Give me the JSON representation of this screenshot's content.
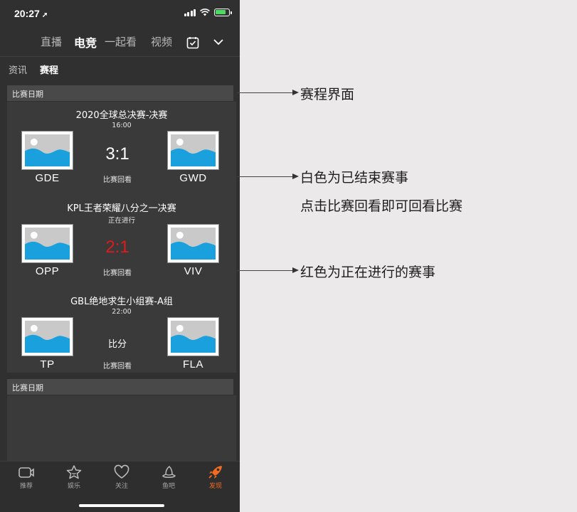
{
  "status_bar": {
    "time": "20:27",
    "location_glyph": "➚"
  },
  "top_tabs": [
    "直播",
    "电竞",
    "一起看",
    "视频"
  ],
  "top_tabs_active": 1,
  "sub_tabs": [
    "资讯",
    "赛程"
  ],
  "sub_tabs_active": 1,
  "date_label": "比赛日期",
  "matches": [
    {
      "title": "2020全球总决赛-决赛",
      "sub": "16:00",
      "team_left": "GDE",
      "team_right": "GWD",
      "score": "3:1",
      "state": "finished",
      "replay": "比赛回看"
    },
    {
      "title": "KPL王者荣耀八分之一决赛",
      "sub": "正在进行",
      "team_left": "OPP",
      "team_right": "VIV",
      "score": "2:1",
      "state": "live",
      "replay": "比赛回看"
    },
    {
      "title": "GBL绝地求生小组赛-A组",
      "sub": "22:00",
      "team_left": "TP",
      "team_right": "FLA",
      "score": "比分",
      "state": "pending",
      "replay": "比赛回看"
    }
  ],
  "date_label_2": "比赛日期",
  "bottom_nav": [
    {
      "label": "推荐",
      "icon": "video-icon"
    },
    {
      "label": "娱乐",
      "icon": "star-face-icon"
    },
    {
      "label": "关注",
      "icon": "heart-icon"
    },
    {
      "label": "鱼吧",
      "icon": "fish-hat-icon"
    },
    {
      "label": "发现",
      "icon": "rocket-icon"
    }
  ],
  "bottom_nav_active": 4,
  "annotations": {
    "schedule": "赛程界面",
    "finished_line1": "白色为已结束赛事",
    "finished_line2": "点击比赛回看即可回看比赛",
    "live": "红色为正在进行的赛事"
  },
  "colors": {
    "live_score": "#e01a1a",
    "nav_active": "#f26b21",
    "panel_bg": "#303030",
    "page_bg": "#ebe9ea"
  }
}
